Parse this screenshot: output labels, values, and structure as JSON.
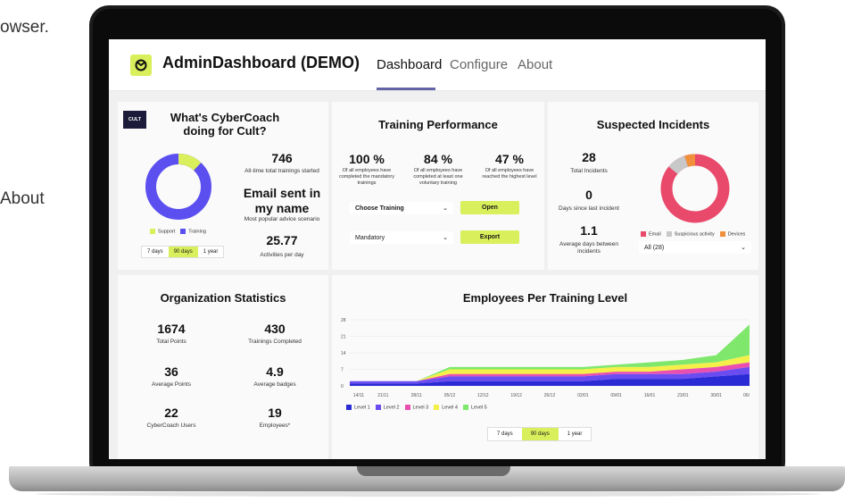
{
  "outside": {
    "text_top": "owser.",
    "text_mid": "About"
  },
  "header": {
    "title": "AdminDashboard (DEMO)",
    "tabs": [
      {
        "label": "Dashboard",
        "active": true
      },
      {
        "label": "Configure"
      },
      {
        "label": "About"
      }
    ]
  },
  "coach": {
    "logo_text": "CULT",
    "title": "What's CyberCoach doing for Cult?",
    "stats": [
      {
        "value": "746",
        "label": "All-time total trainings started"
      },
      {
        "value": "Email sent in my name",
        "label": "Most popular advice scenario"
      },
      {
        "value": "25.77",
        "label": "Activities per day"
      }
    ],
    "legend": [
      {
        "label": "Support",
        "color": "#d9ef5b"
      },
      {
        "label": "Training",
        "color": "#5b4ff0"
      }
    ],
    "donut_fractions": {
      "Support": 0.12,
      "Training": 0.88
    },
    "ranges": [
      "7 days",
      "90 days",
      "1 year"
    ],
    "active_range": "90 days"
  },
  "training": {
    "title": "Training Performance",
    "stats": [
      {
        "value": "100 %",
        "label": "Of all employees have completed the mandatory trainings"
      },
      {
        "value": "84 %",
        "label": "Of all employees have completed at least one voluntary training"
      },
      {
        "value": "47 %",
        "label": "Of all employees have reached the highest level"
      }
    ],
    "dropdown1": "Choose Training",
    "dropdown2": "Mandatory",
    "open_label": "Open",
    "export_label": "Export"
  },
  "incidents": {
    "title": "Suspected Incidents",
    "stats": [
      {
        "value": "28",
        "label": "Total Incidents"
      },
      {
        "value": "0",
        "label": "Days since last incident"
      },
      {
        "value": "1.1",
        "label": "Average days between incidents"
      }
    ],
    "legend": [
      {
        "label": "Email",
        "color": "#e9496a"
      },
      {
        "label": "Suspicious activity",
        "color": "#c8c8c8"
      },
      {
        "label": "Devices",
        "color": "#f0903c"
      }
    ],
    "donut_fractions": {
      "Email": 0.86,
      "Suspicious activity": 0.09,
      "Devices": 0.05
    },
    "filter": "All (28)"
  },
  "org": {
    "title": "Organization Statistics",
    "stats": [
      {
        "value": "1674",
        "label": "Total Points"
      },
      {
        "value": "430",
        "label": "Trainings Completed"
      },
      {
        "value": "36",
        "label": "Average Points"
      },
      {
        "value": "4.9",
        "label": "Average badges"
      },
      {
        "value": "22",
        "label": "CyberCoach Users"
      },
      {
        "value": "19",
        "label": "Employees*"
      }
    ]
  },
  "chart_data": {
    "type": "area",
    "title": "Employees Per Training Level",
    "x": [
      "14/11",
      "21/11",
      "28/11",
      "05/12",
      "12/12",
      "19/12",
      "26/12",
      "02/01",
      "09/01",
      "16/01",
      "23/01",
      "30/01",
      "06/"
    ],
    "y_ticks": [
      "0",
      "7",
      "14",
      "21",
      "28"
    ],
    "ylim": [
      0,
      28
    ],
    "series": [
      {
        "name": "Level 1",
        "color": "#2b2bd6",
        "values": [
          1,
          1,
          1,
          2,
          2,
          2,
          2,
          2,
          3,
          3,
          3,
          4,
          5
        ]
      },
      {
        "name": "Level 2",
        "color": "#6a4cf0",
        "values": [
          1,
          1,
          1,
          2,
          2,
          2,
          2,
          2,
          2,
          2,
          2,
          2,
          3
        ]
      },
      {
        "name": "Level 3",
        "color": "#e94fb0",
        "values": [
          0,
          0,
          0,
          1,
          1,
          1,
          1,
          1,
          1,
          1,
          2,
          2,
          2
        ]
      },
      {
        "name": "Level 4",
        "color": "#f5ef4a",
        "values": [
          0,
          0,
          0,
          2,
          2,
          2,
          2,
          2,
          2,
          2,
          2,
          2,
          3
        ]
      },
      {
        "name": "Level 5",
        "color": "#7fe86c",
        "values": [
          0,
          0,
          0,
          1,
          1,
          1,
          1,
          1,
          1,
          2,
          2,
          3,
          13
        ]
      }
    ],
    "ranges": [
      "7 days",
      "90 days",
      "1 year"
    ],
    "active_range": "90 days"
  }
}
